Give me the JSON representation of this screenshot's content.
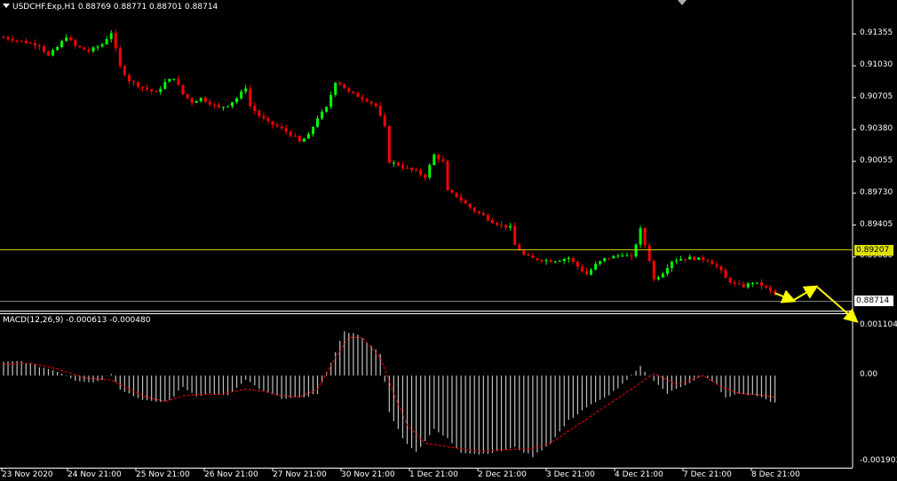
{
  "header": {
    "symbol_line": "USDCHF.Exp,H1  0.88769 0.88771 0.88701 0.88714",
    "macd_label": "MACD(12,26,9) -0.000613 -0.000480"
  },
  "colors": {
    "background": "#000000",
    "bull_candle": "#00ff00",
    "bear_candle": "#ff0000",
    "support_line": "#c8c800",
    "arrows": "#ffff00",
    "macd_hist": "#c0c0c0",
    "macd_signal": "#ff0000"
  },
  "chart_data": [
    {
      "type": "candlestick",
      "symbol": "USDCHF.Exp",
      "timeframe": "H1",
      "ohlc_header": {
        "open": 0.88769,
        "high": 0.88771,
        "low": 0.88701,
        "close": 0.88714
      },
      "y_ticks": [
        0.91355,
        0.9103,
        0.90705,
        0.9038,
        0.90055,
        0.8973,
        0.89405,
        0.8908
      ],
      "ylim": [
        0.8855,
        0.9152
      ],
      "horizontal_line": {
        "value": "0.89207"
      },
      "current_price": "0.88714",
      "x_labels": [
        "23 Nov 2020",
        "24 Nov 21:00",
        "25 Nov 21:00",
        "26 Nov 21:00",
        "27 Nov 21:00",
        "30 Nov 21:00",
        "1 Dec 21:00",
        "2 Dec 21:00",
        "3 Dec 21:00",
        "4 Dec 21:00",
        "7 Dec 21:00",
        "8 Dec 21:00"
      ],
      "close_path": [
        [
          0,
          0.9132
        ],
        [
          4,
          0.9128
        ],
        [
          8,
          0.9124
        ],
        [
          10,
          0.9113
        ],
        [
          12,
          0.9122
        ],
        [
          14,
          0.9133
        ],
        [
          16,
          0.9123
        ],
        [
          19,
          0.9118
        ],
        [
          22,
          0.9125
        ],
        [
          24,
          0.9137
        ],
        [
          26,
          0.9102
        ],
        [
          28,
          0.9088
        ],
        [
          30,
          0.9083
        ],
        [
          32,
          0.9079
        ],
        [
          34,
          0.9075
        ],
        [
          36,
          0.9086
        ],
        [
          38,
          0.9091
        ],
        [
          40,
          0.9074
        ],
        [
          42,
          0.9066
        ],
        [
          44,
          0.907
        ],
        [
          46,
          0.9065
        ],
        [
          48,
          0.906
        ],
        [
          50,
          0.9063
        ],
        [
          52,
          0.907
        ],
        [
          54,
          0.9081
        ],
        [
          55,
          0.9062
        ],
        [
          57,
          0.9052
        ],
        [
          59,
          0.9045
        ],
        [
          61,
          0.9041
        ],
        [
          63,
          0.9036
        ],
        [
          65,
          0.903
        ],
        [
          66,
          0.9025
        ],
        [
          68,
          0.9032
        ],
        [
          70,
          0.905
        ],
        [
          72,
          0.906
        ],
        [
          74,
          0.9087
        ],
        [
          75,
          0.9085
        ],
        [
          77,
          0.9076
        ],
        [
          79,
          0.9072
        ],
        [
          81,
          0.9068
        ],
        [
          83,
          0.9062
        ],
        [
          85,
          0.904
        ],
        [
          86,
          0.9005
        ],
        [
          88,
          0.9002
        ],
        [
          90,
          0.8998
        ],
        [
          92,
          0.8995
        ],
        [
          94,
          0.899
        ],
        [
          96,
          0.9012
        ],
        [
          98,
          0.9005
        ],
        [
          99,
          0.8975
        ],
        [
          101,
          0.897
        ],
        [
          103,
          0.8962
        ],
        [
          105,
          0.8955
        ],
        [
          107,
          0.895
        ],
        [
          109,
          0.8944
        ],
        [
          111,
          0.894
        ],
        [
          113,
          0.8938
        ],
        [
          114,
          0.892
        ],
        [
          116,
          0.891
        ],
        [
          118,
          0.8906
        ],
        [
          120,
          0.8905
        ],
        [
          122,
          0.8904
        ],
        [
          124,
          0.8905
        ],
        [
          126,
          0.8907
        ],
        [
          128,
          0.8898
        ],
        [
          130,
          0.889
        ],
        [
          132,
          0.89
        ],
        [
          134,
          0.8906
        ],
        [
          136,
          0.8908
        ],
        [
          138,
          0.8911
        ],
        [
          140,
          0.8907
        ],
        [
          142,
          0.8936
        ],
        [
          143,
          0.892
        ],
        [
          144,
          0.8905
        ],
        [
          145,
          0.8885
        ],
        [
          147,
          0.8892
        ],
        [
          149,
          0.8904
        ],
        [
          151,
          0.8906
        ],
        [
          153,
          0.8907
        ],
        [
          155,
          0.8906
        ],
        [
          157,
          0.8905
        ],
        [
          159,
          0.8898
        ],
        [
          160,
          0.8893
        ],
        [
          161,
          0.8886
        ],
        [
          163,
          0.888
        ],
        [
          165,
          0.8878
        ],
        [
          167,
          0.8882
        ],
        [
          169,
          0.8879
        ],
        [
          170,
          0.8876
        ],
        [
          171,
          0.8873
        ],
        [
          172,
          0.8871
        ]
      ],
      "projection_arrows": [
        {
          "from": [
            172,
            0.8871
          ],
          "to": [
            176,
            0.88635
          ]
        },
        {
          "from": [
            176,
            0.88635
          ],
          "to": [
            181,
            0.8877
          ]
        },
        {
          "from": [
            181.5,
            0.8877
          ],
          "to": [
            190,
            0.8843
          ]
        }
      ]
    },
    {
      "type": "macd",
      "params": "12,26,9",
      "values": {
        "macd": -0.000613,
        "signal": -0.00048
      },
      "y_ticks": [
        0.001104,
        0.0,
        -0.001903
      ],
      "ylim": [
        -0.00205,
        0.00125
      ],
      "hist_path": [
        [
          0,
          0.0003
        ],
        [
          4,
          0.00032
        ],
        [
          8,
          0.0002
        ],
        [
          12,
          0.0001
        ],
        [
          16,
          -0.0001
        ],
        [
          20,
          -0.00015
        ],
        [
          22,
          -8e-05
        ],
        [
          24,
          5e-05
        ],
        [
          26,
          -0.0003
        ],
        [
          30,
          -0.0005
        ],
        [
          34,
          -0.0006
        ],
        [
          37,
          -0.00055
        ],
        [
          40,
          -0.00025
        ],
        [
          43,
          -0.00045
        ],
        [
          46,
          -0.0004
        ],
        [
          50,
          -0.00045
        ],
        [
          54,
          -0.0001
        ],
        [
          58,
          -0.00035
        ],
        [
          62,
          -0.0005
        ],
        [
          66,
          -0.0005
        ],
        [
          70,
          -0.0004
        ],
        [
          73,
          0.0003
        ],
        [
          76,
          0.001
        ],
        [
          79,
          0.0009
        ],
        [
          84,
          0.0005
        ],
        [
          86,
          -0.0008
        ],
        [
          89,
          -0.0014
        ],
        [
          92,
          -0.0017
        ],
        [
          96,
          -0.0012
        ],
        [
          99,
          -0.0014
        ],
        [
          102,
          -0.0017
        ],
        [
          106,
          -0.00175
        ],
        [
          110,
          -0.0017
        ],
        [
          114,
          -0.0016
        ],
        [
          118,
          -0.0018
        ],
        [
          122,
          -0.0015
        ],
        [
          126,
          -0.001
        ],
        [
          130,
          -0.0007
        ],
        [
          134,
          -0.0005
        ],
        [
          138,
          -0.0002
        ],
        [
          142,
          0.0002
        ],
        [
          145,
          -0.0001
        ],
        [
          148,
          -0.0004
        ],
        [
          152,
          -0.0002
        ],
        [
          156,
          0.0
        ],
        [
          159,
          -0.0002
        ],
        [
          161,
          -0.0005
        ],
        [
          164,
          -0.0004
        ],
        [
          168,
          -0.00045
        ],
        [
          172,
          -0.00061
        ]
      ],
      "signal_path": [
        [
          0,
          0.00025
        ],
        [
          6,
          0.00028
        ],
        [
          12,
          0.00015
        ],
        [
          18,
          -5e-05
        ],
        [
          24,
          -0.0001
        ],
        [
          28,
          -0.0003
        ],
        [
          32,
          -0.00048
        ],
        [
          36,
          -0.00058
        ],
        [
          40,
          -0.00045
        ],
        [
          44,
          -0.00042
        ],
        [
          48,
          -0.00042
        ],
        [
          54,
          -0.0003
        ],
        [
          58,
          -0.00035
        ],
        [
          62,
          -0.00045
        ],
        [
          66,
          -0.00048
        ],
        [
          70,
          -0.0003
        ],
        [
          74,
          0.0004
        ],
        [
          77,
          0.00085
        ],
        [
          80,
          0.00085
        ],
        [
          84,
          0.0004
        ],
        [
          87,
          -0.0004
        ],
        [
          90,
          -0.0011
        ],
        [
          94,
          -0.0015
        ],
        [
          100,
          -0.0016
        ],
        [
          106,
          -0.00168
        ],
        [
          112,
          -0.00165
        ],
        [
          118,
          -0.00162
        ],
        [
          122,
          -0.0015
        ],
        [
          128,
          -0.0011
        ],
        [
          134,
          -0.0007
        ],
        [
          140,
          -0.0003
        ],
        [
          145,
          5e-05
        ],
        [
          150,
          -0.0002
        ],
        [
          156,
          0.0
        ],
        [
          160,
          -0.00025
        ],
        [
          164,
          -0.0004
        ],
        [
          168,
          -0.00042
        ],
        [
          172,
          -0.00048
        ]
      ]
    }
  ]
}
